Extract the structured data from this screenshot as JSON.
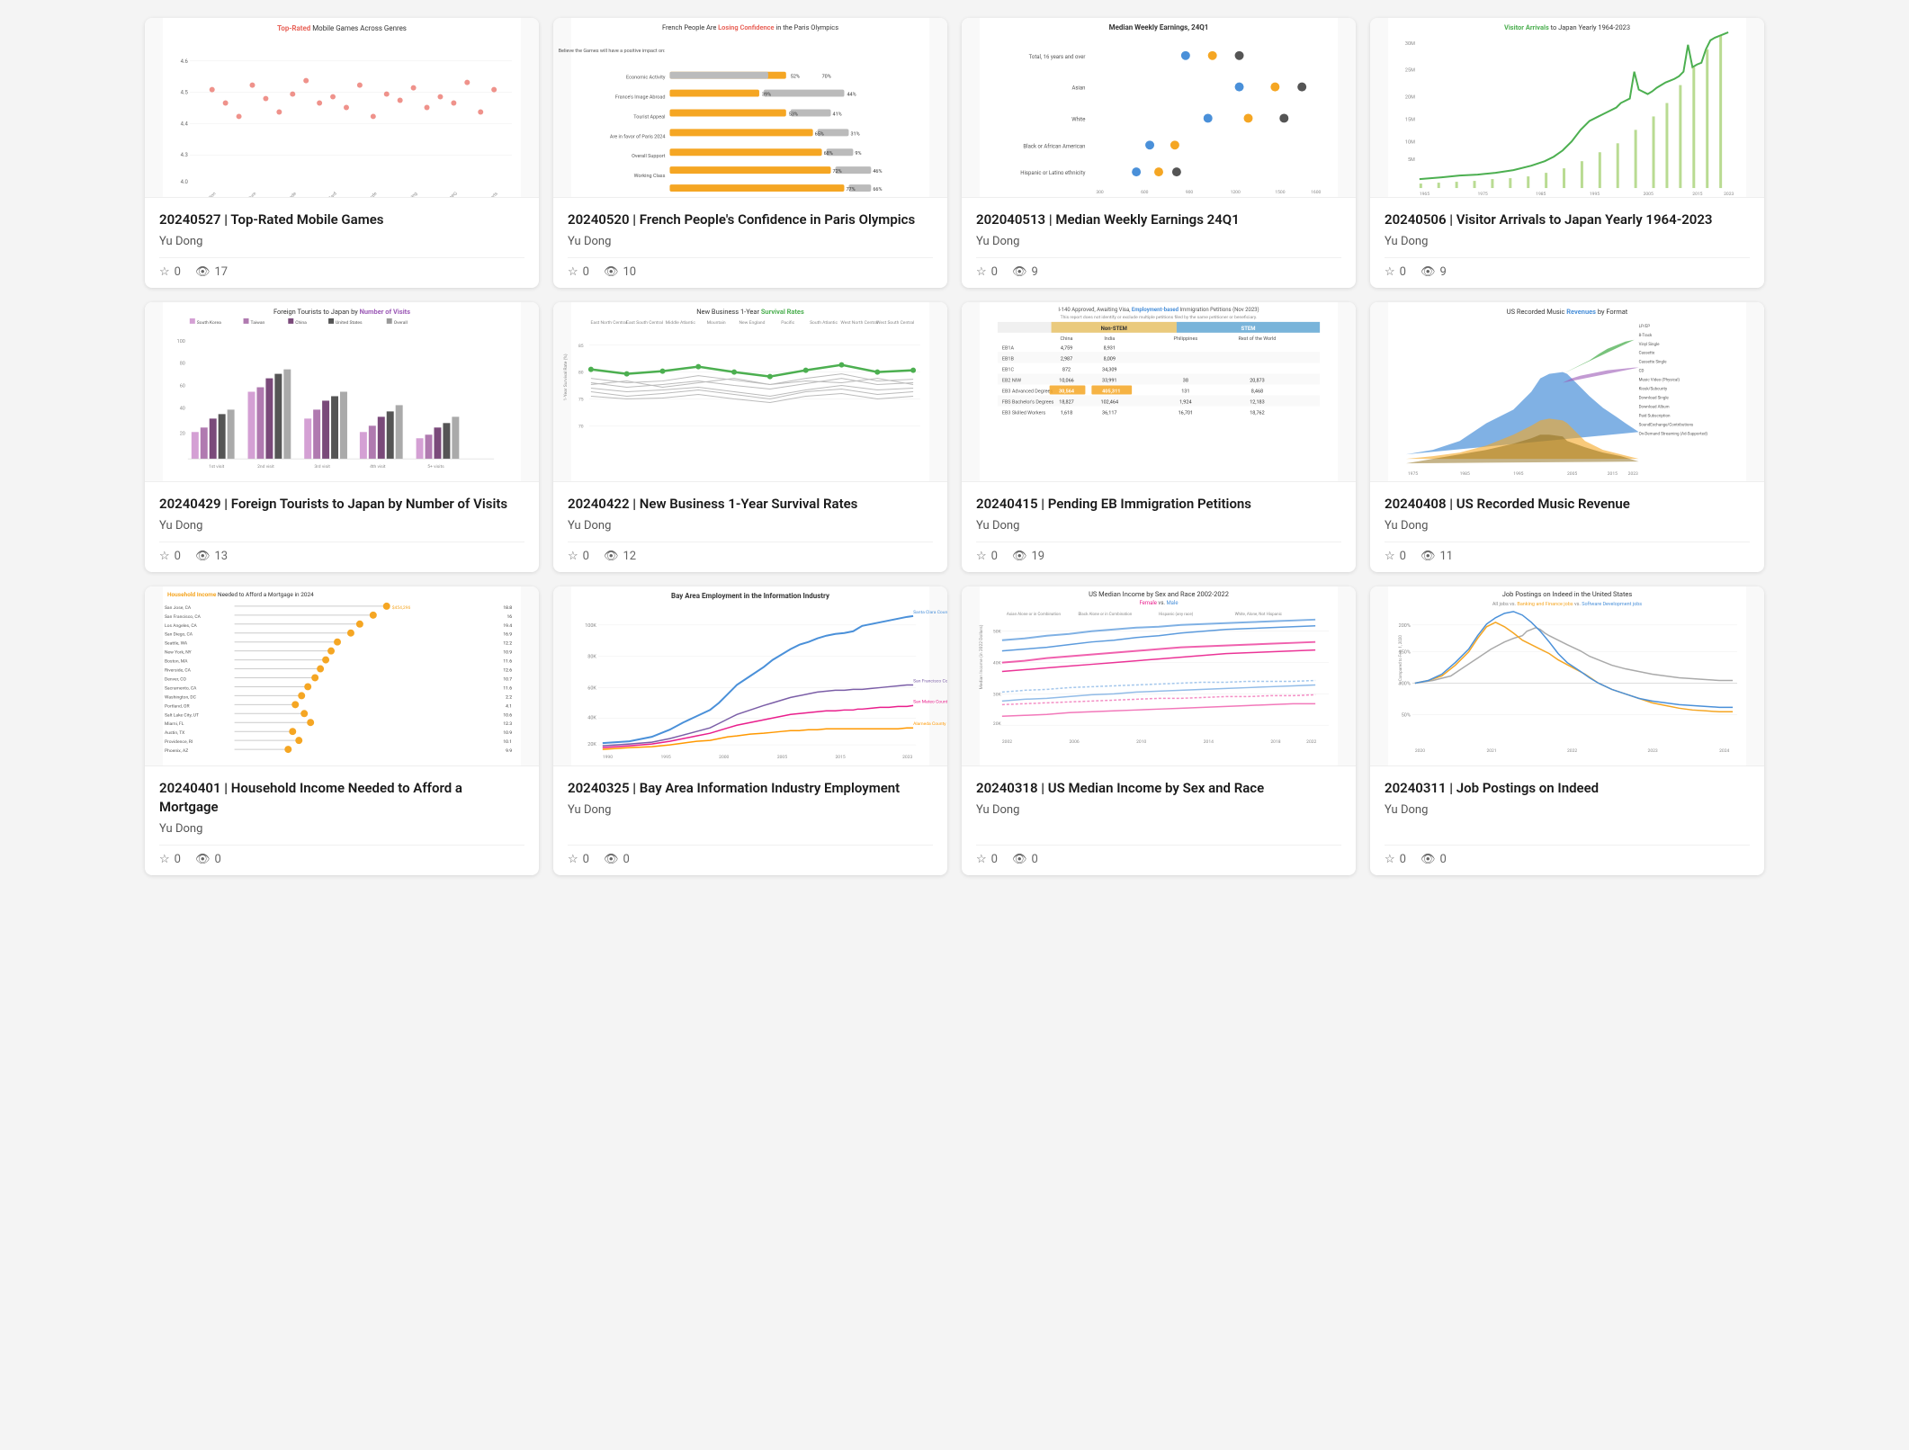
{
  "cards": [
    {
      "id": "card-1",
      "title": "20240527 | Top-Rated Mobile Games",
      "author": "Yu Dong",
      "stars": "0",
      "views": "17",
      "chart_type": "scatter",
      "chart_title": "Top-Rated Mobile Games Across Genres",
      "chart_title_highlight": "Top-Rated"
    },
    {
      "id": "card-2",
      "title": "20240520 | French People's Confidence in Paris Olympics",
      "author": "Yu Dong",
      "stars": "0",
      "views": "10",
      "chart_type": "diverging_bar",
      "chart_title": "French People Are Losing Confidence in the Paris Olympics",
      "chart_title_highlight": "Losing Confidence"
    },
    {
      "id": "card-3",
      "title": "202040513 | Median Weekly Earnings 24Q1",
      "author": "Yu Dong",
      "stars": "0",
      "views": "9",
      "chart_type": "dot_plot",
      "chart_title": "Median Weekly Earnings, 24Q1"
    },
    {
      "id": "card-4",
      "title": "20240506 | Visitor Arrivals to Japan Yearly 1964-2023",
      "author": "Yu Dong",
      "stars": "0",
      "views": "9",
      "chart_type": "line",
      "chart_title": "Visitor Arrivals to Japan Yearly 1964-2023",
      "chart_title_highlight": "Visitor Arrivals"
    },
    {
      "id": "card-5",
      "title": "20240429 | Foreign Tourists to Japan by Number of Visits",
      "author": "Yu Dong",
      "stars": "0",
      "views": "13",
      "chart_type": "bar",
      "chart_title": "Foreign Tourists to Japan by Number of Visits",
      "chart_title_highlight": "Number of Visits"
    },
    {
      "id": "card-6",
      "title": "20240422 | New Business 1-Year Survival Rates",
      "author": "Yu Dong",
      "stars": "0",
      "views": "12",
      "chart_type": "line_multi",
      "chart_title": "New Business 1-Year Survival Rates",
      "chart_title_highlight": "Survival Rates"
    },
    {
      "id": "card-7",
      "title": "20240415 | Pending EB Immigration Petitions",
      "author": "Yu Dong",
      "stars": "0",
      "views": "19",
      "chart_type": "table",
      "chart_title": "I-140 Approved, Awaiting Visa, Employment-based Immigration Petitions (Nov 2023)"
    },
    {
      "id": "card-8",
      "title": "20240408 | US Recorded Music Revenue",
      "author": "Yu Dong",
      "stars": "0",
      "views": "11",
      "chart_type": "area",
      "chart_title": "US Recorded Music Revenues by Format",
      "chart_title_highlight": "Revenues"
    },
    {
      "id": "card-9",
      "title": "20240401 | Household Income Needed to Afford a Mortgage",
      "author": "Yu Dong",
      "stars": "0",
      "views": "0",
      "chart_type": "lollipop",
      "chart_title": "Household Income Needed to Afford a Mortgage in 2024",
      "chart_title_highlight": "Household Income"
    },
    {
      "id": "card-10",
      "title": "20240325 | Bay Area Information Industry Employment",
      "author": "Yu Dong",
      "stars": "0",
      "views": "0",
      "chart_type": "line_area",
      "chart_title": "Bay Area Employment in the Information Industry"
    },
    {
      "id": "card-11",
      "title": "20240318 | US Median Income by Sex and Race",
      "author": "Yu Dong",
      "stars": "0",
      "views": "0",
      "chart_type": "line_multi2",
      "chart_title": "US Median Income by Sex and Race 2002-2022"
    },
    {
      "id": "card-12",
      "title": "20240311 | Job Postings on Indeed",
      "author": "Yu Dong",
      "stars": "0",
      "views": "0",
      "chart_type": "line_multi3",
      "chart_title": "Job Postings on Indeed in the United States"
    }
  ]
}
